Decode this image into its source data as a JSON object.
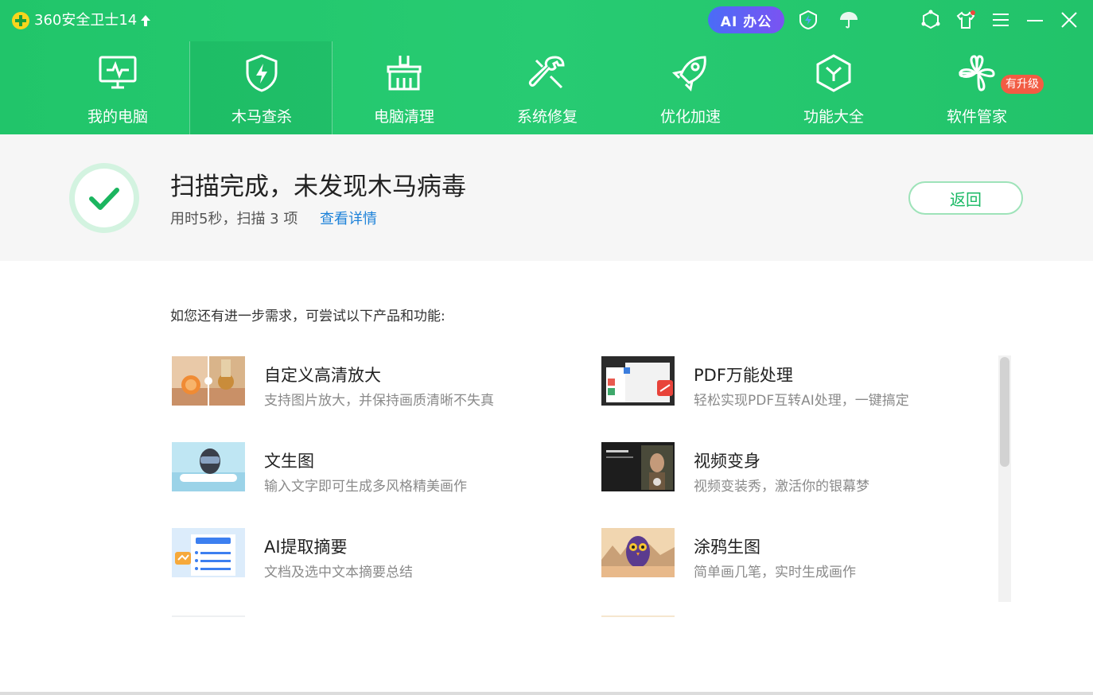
{
  "app": {
    "title": "360安全卫士14",
    "ai_office_label": "AI 办公"
  },
  "titlebar_icons": [
    "bolt-shield-icon",
    "umbrella-icon",
    "hexagon-ring-icon",
    "shirt-icon",
    "menu-icon",
    "minimize-icon",
    "close-icon"
  ],
  "nav": {
    "items": [
      {
        "label": "我的电脑",
        "icon": "monitor-pulse-icon"
      },
      {
        "label": "木马查杀",
        "icon": "shield-bolt-icon",
        "active": true
      },
      {
        "label": "电脑清理",
        "icon": "broom-icon"
      },
      {
        "label": "系统修复",
        "icon": "wrench-icon"
      },
      {
        "label": "优化加速",
        "icon": "rocket-icon"
      },
      {
        "label": "功能大全",
        "icon": "hexagon-y-icon"
      },
      {
        "label": "软件管家",
        "icon": "clover-icon",
        "badge": "有升级"
      }
    ]
  },
  "status": {
    "title": "扫描完成，未发现木马病毒",
    "subtitle": "用时5秒，扫描 3 项",
    "link": "查看详情",
    "back_button": "返回"
  },
  "suggest": {
    "heading": "如您还有进一步需求，可尝试以下产品和功能:",
    "items": [
      {
        "title": "自定义高清放大",
        "desc": "支持图片放大，并保持画质清晰不失真",
        "thumb": "fruit-photo"
      },
      {
        "title": "PDF万能处理",
        "desc": "轻松实现PDF互转AI处理，一键搞定",
        "thumb": "pdf-app"
      },
      {
        "title": "文生图",
        "desc": "输入文字即可生成多风格精美画作",
        "thumb": "vr-girl"
      },
      {
        "title": "视频变身",
        "desc": "视频变装秀，激活你的银幕梦",
        "thumb": "video-portrait"
      },
      {
        "title": "AI提取摘要",
        "desc": "文档及选中文本摘要总结",
        "thumb": "ai-summary-doc"
      },
      {
        "title": "涂鸦生图",
        "desc": "简单画几笔，实时生成画作",
        "thumb": "owl-painting"
      }
    ]
  },
  "colors": {
    "brand_green": "#21c56a",
    "link_blue": "#1d82d9",
    "badge_red": "#f25c43",
    "ai_gradient_start": "#4a6cf7",
    "ai_gradient_end": "#7b53f2"
  }
}
